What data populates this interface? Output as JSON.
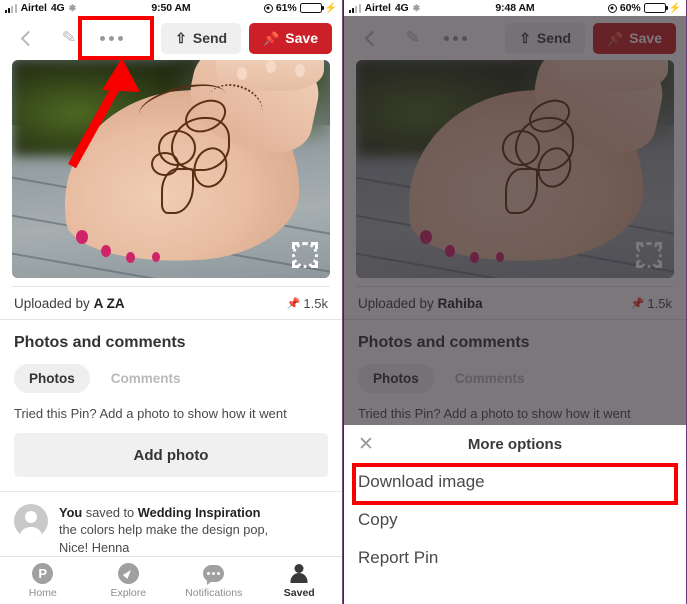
{
  "left_phone": {
    "status_bar": {
      "carrier": "Airtel",
      "network": "4G",
      "time": "9:50 AM",
      "battery_percent": "61%"
    },
    "navbar": {
      "back_icon": "chevron-left-icon",
      "edit_icon": "pencil-icon",
      "more_icon": "more-dots-icon",
      "send_label": "Send",
      "save_label": "Save"
    },
    "pin": {
      "image_alt": "henna tattoo on foot",
      "fullscreen_icon": "fullscreen-icon",
      "uploaded_prefix": "Uploaded by",
      "uploaded_by": "A ZA",
      "save_count": "1.5k"
    },
    "photos_section": {
      "title": "Photos and comments",
      "tab_photos": "Photos",
      "tab_comments": "Comments",
      "hint": "Tried this Pin? Add a photo to show how it went",
      "add_photo_label": "Add photo"
    },
    "comment": {
      "user": "You",
      "action": " saved to ",
      "board": "Wedding Inspiration",
      "line2": "the colors help make the design pop,",
      "line3": "Nice! Henna"
    },
    "bottom_nav": [
      {
        "label": "Home",
        "icon": "pinterest-icon",
        "active": false
      },
      {
        "label": "Explore",
        "icon": "compass-icon",
        "active": false
      },
      {
        "label": "Notifications",
        "icon": "chat-bubble-icon",
        "active": false
      },
      {
        "label": "Saved",
        "icon": "person-icon",
        "active": true
      }
    ]
  },
  "right_phone": {
    "status_bar": {
      "carrier": "Airtel",
      "network": "4G",
      "time": "9:48 AM",
      "battery_percent": "60%"
    },
    "navbar": {
      "send_label": "Send",
      "save_label": "Save"
    },
    "pin": {
      "uploaded_prefix": "Uploaded by",
      "uploaded_by": "Rahiba",
      "save_count": "1.5k"
    },
    "photos_section": {
      "title": "Photos and comments",
      "tab_photos": "Photos",
      "tab_comments": "Comments",
      "hint": "Tried this Pin? Add a photo to show how it went"
    },
    "sheet": {
      "close_icon": "close-icon",
      "title": "More options",
      "items": [
        "Download image",
        "Copy",
        "Report Pin"
      ]
    }
  },
  "annotations": {
    "highlight_color": "#f80000",
    "box_more_button": "more-options-button",
    "box_download_image": "download-image-row"
  }
}
